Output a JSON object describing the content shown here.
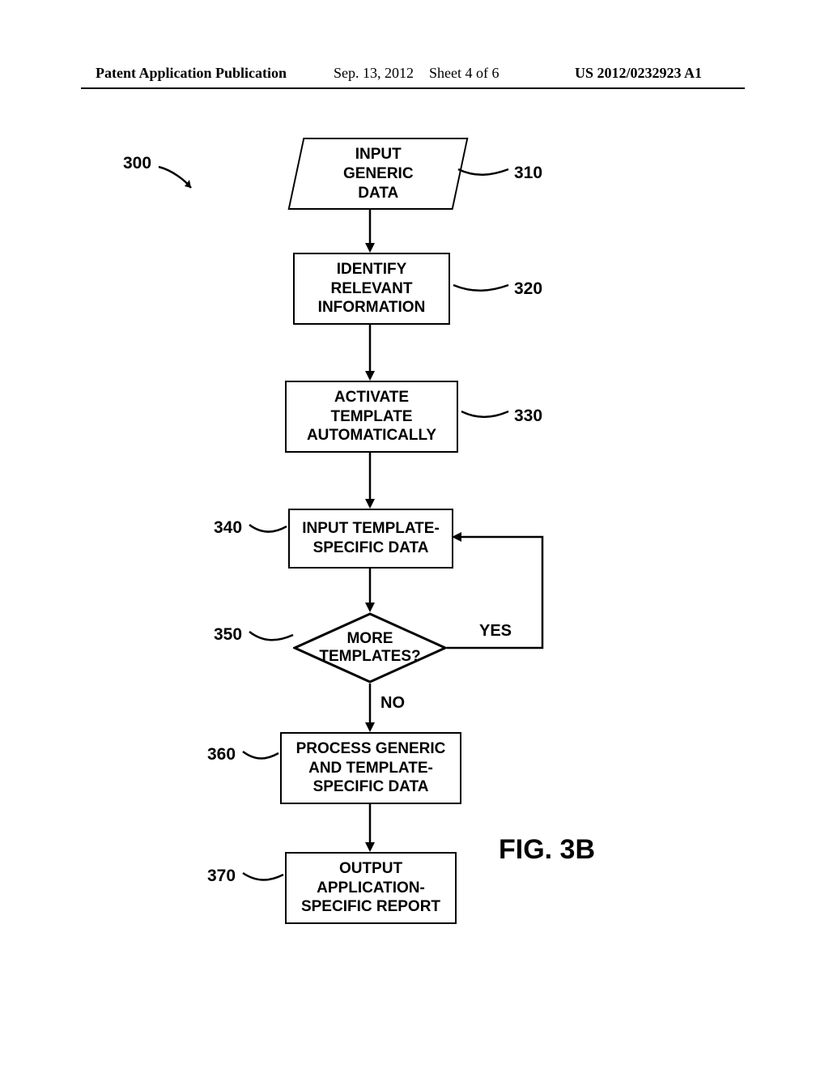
{
  "header": {
    "publication": "Patent Application Publication",
    "date": "Sep. 13, 2012",
    "sheet": "Sheet 4 of 6",
    "pubno": "US 2012/0232923 A1"
  },
  "flow": {
    "ref300": "300",
    "step310": {
      "label": "INPUT\nGENERIC\nDATA",
      "ref": "310"
    },
    "step320": {
      "label": "IDENTIFY\nRELEVANT\nINFORMATION",
      "ref": "320"
    },
    "step330": {
      "label": "ACTIVATE\nTEMPLATE\nAUTOMATICALLY",
      "ref": "330"
    },
    "step340": {
      "label": "INPUT TEMPLATE-\nSPECIFIC DATA",
      "ref": "340"
    },
    "step350": {
      "label": "MORE\nTEMPLATES?",
      "ref": "350",
      "yes": "YES",
      "no": "NO"
    },
    "step360": {
      "label": "PROCESS GENERIC\nAND TEMPLATE-\nSPECIFIC DATA",
      "ref": "360"
    },
    "step370": {
      "label": "OUTPUT\nAPPLICATION-\nSPECIFIC REPORT",
      "ref": "370"
    }
  },
  "figure": "FIG. 3B"
}
